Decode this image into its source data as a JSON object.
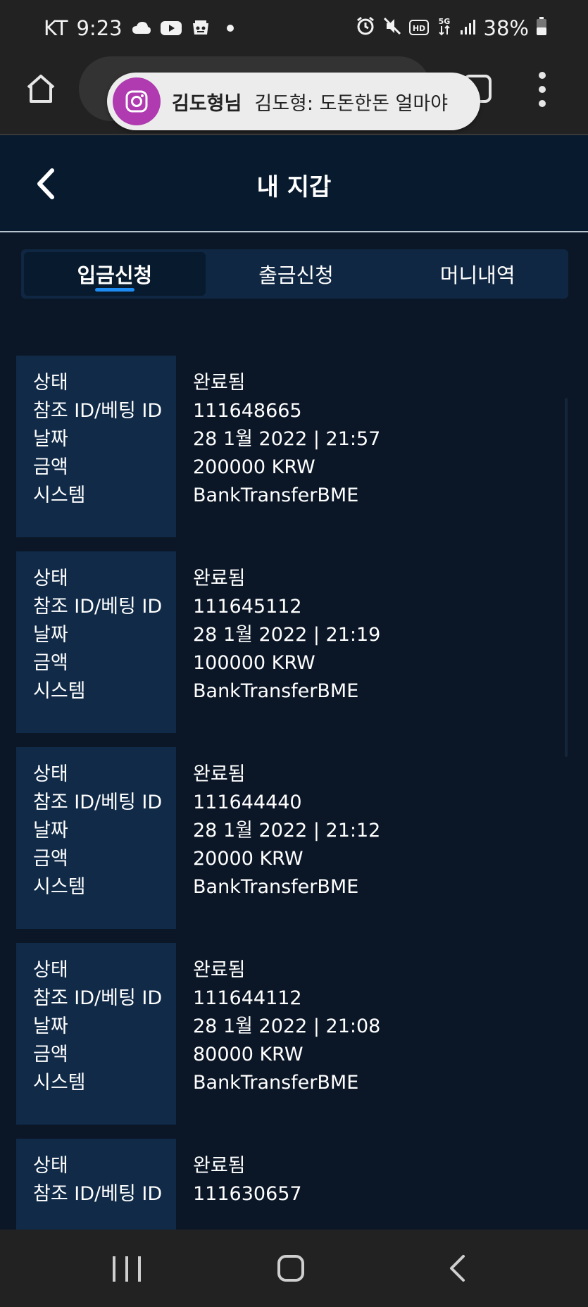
{
  "status_bar": {
    "carrier": "KT",
    "time": "9:23",
    "network": "5G",
    "hd": "HD",
    "battery": "38%"
  },
  "notification": {
    "app_icon": "instagram-icon",
    "sender": "김도형님",
    "message": "김도형: 도돈한돈 얼마야"
  },
  "header": {
    "title": "내 지갑"
  },
  "tabs": [
    {
      "label": "입금신청",
      "active": true
    },
    {
      "label": "출금신청",
      "active": false
    },
    {
      "label": "머니내역",
      "active": false
    }
  ],
  "labels": {
    "status": "상태",
    "ref_id": "참조 ID/베팅 ID",
    "date": "날짜",
    "amount": "금액",
    "system": "시스템"
  },
  "records": [
    {
      "status": "완료됨",
      "ref_id": "111648665",
      "date": "28 1월 2022 | 21:57",
      "amount": "200000 KRW",
      "system": "BankTransferBME"
    },
    {
      "status": "완료됨",
      "ref_id": "111645112",
      "date": "28 1월 2022 | 21:19",
      "amount": "100000 KRW",
      "system": "BankTransferBME"
    },
    {
      "status": "완료됨",
      "ref_id": "111644440",
      "date": "28 1월 2022 | 21:12",
      "amount": "20000 KRW",
      "system": "BankTransferBME"
    },
    {
      "status": "완료됨",
      "ref_id": "111644112",
      "date": "28 1월 2022 | 21:08",
      "amount": "80000 KRW",
      "system": "BankTransferBME"
    },
    {
      "status": "완료됨",
      "ref_id": "111630657",
      "date": "",
      "amount": "",
      "system": ""
    }
  ],
  "colors": {
    "header_bg": "#071a2e",
    "content_bg": "#0b1727",
    "label_bg": "#102a48",
    "accent": "#1e8cf2",
    "instagram": "#b03ab0"
  }
}
